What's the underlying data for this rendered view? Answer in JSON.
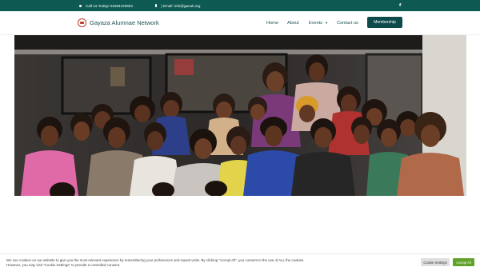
{
  "topbar": {
    "phone_text": "Call Us Today! 02084233603",
    "email_text": "| Email: info@ganuk.org",
    "social_icon": "facebook-icon"
  },
  "header": {
    "site_name": "Gayaza Alumnae Network",
    "nav": {
      "home": "Home",
      "about": "About",
      "events": "Events",
      "contact": "Contact us"
    },
    "membership_label": "Membership"
  },
  "cookie": {
    "message_line1": "We use cookies on our website to give you the most relevant experience by remembering your preferences and repeat visits. By clicking “Accept All”, you consent to the use of ALL the cookies.",
    "message_line2": "However, you may visit \"Cookie Settings\" to provide a controlled consent.",
    "settings_label": "Cookie Settings",
    "accept_label": "Accept All"
  },
  "colors": {
    "topbar_bg": "#0d5a52",
    "nav_text": "#1d4f55",
    "membership_bg": "#0d4b4b",
    "accept_bg": "#61a229"
  }
}
